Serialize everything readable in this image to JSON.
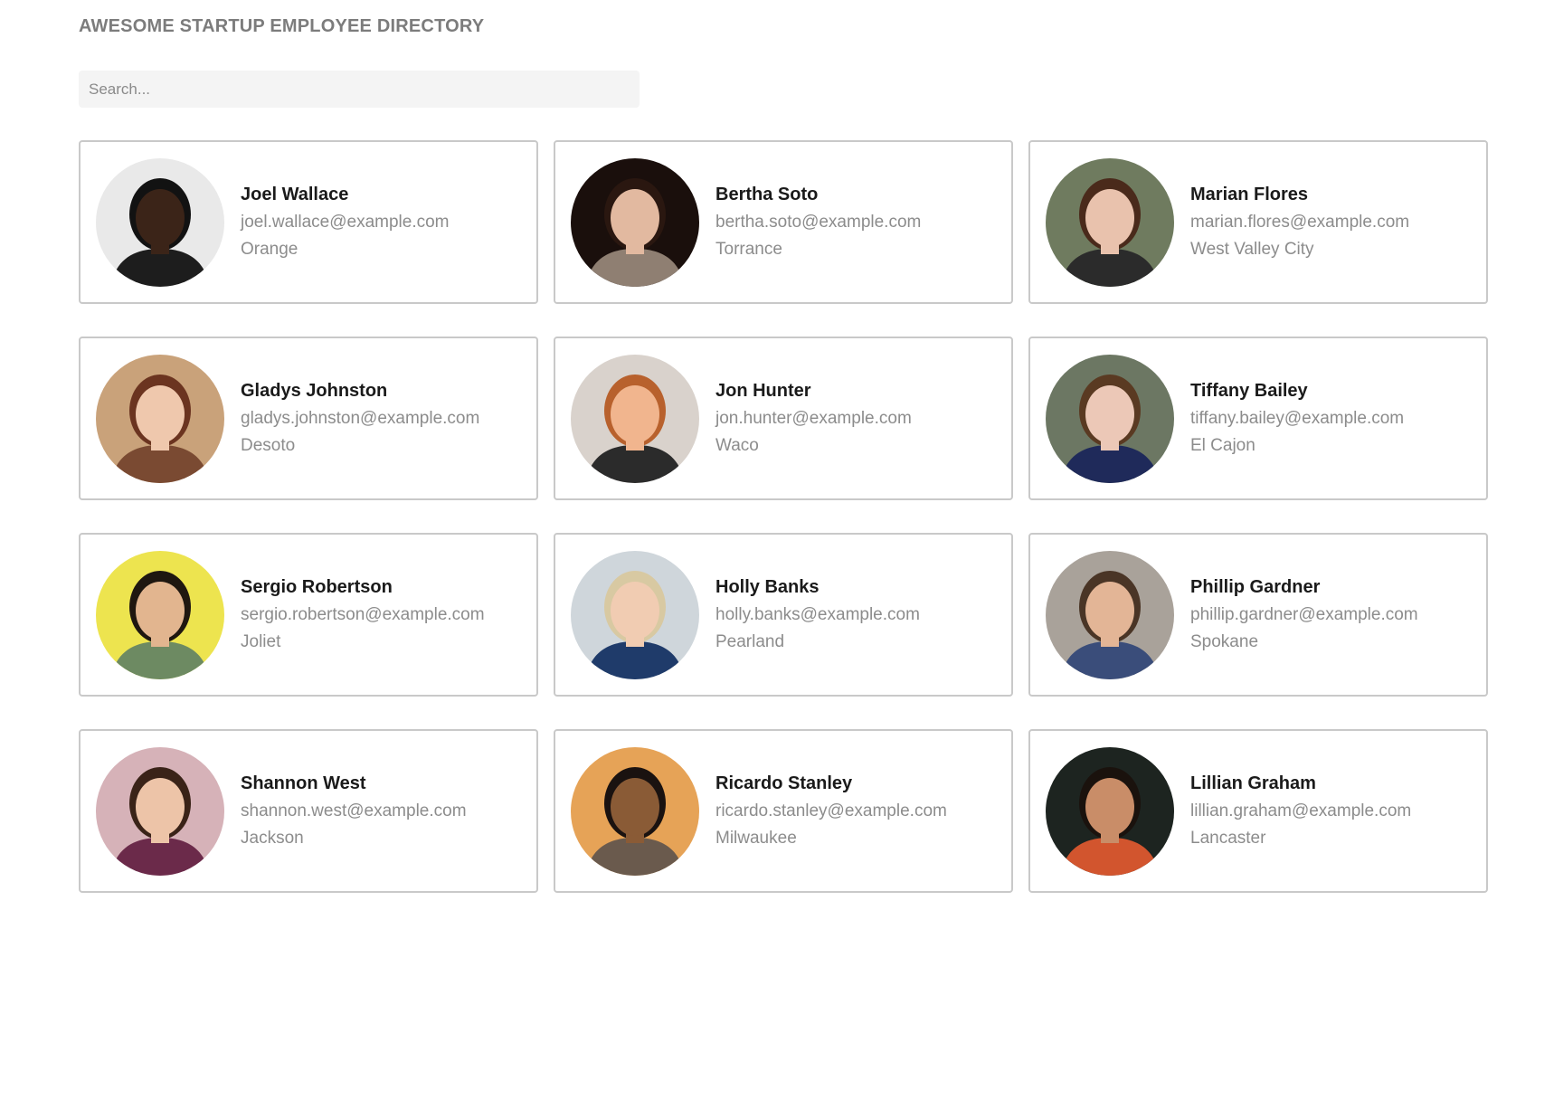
{
  "header": {
    "title": "AWESOME STARTUP EMPLOYEE DIRECTORY"
  },
  "search": {
    "placeholder": "Search..."
  },
  "employees": [
    {
      "name": "Joel Wallace",
      "email": "joel.wallace@example.com",
      "city": "Orange",
      "avatar_bg": "#e9e9e9",
      "skin": "#3b2418",
      "hair": "#121212",
      "shirt": "#1d1d1d"
    },
    {
      "name": "Bertha Soto",
      "email": "bertha.soto@example.com",
      "city": "Torrance",
      "avatar_bg": "#1a0f0c",
      "skin": "#e2b9a0",
      "hair": "#2a1710",
      "shirt": "#8f7f72"
    },
    {
      "name": "Marian Flores",
      "email": "marian.flores@example.com",
      "city": "West Valley City",
      "avatar_bg": "#6f7b5f",
      "skin": "#e9c2ad",
      "hair": "#4a2a1b",
      "shirt": "#2b2b2b"
    },
    {
      "name": "Gladys Johnston",
      "email": "gladys.johnston@example.com",
      "city": "Desoto",
      "avatar_bg": "#c9a27a",
      "skin": "#efc8ad",
      "hair": "#6b3420",
      "shirt": "#7a4a32"
    },
    {
      "name": "Jon Hunter",
      "email": "jon.hunter@example.com",
      "city": "Waco",
      "avatar_bg": "#d9d2cc",
      "skin": "#f1b58e",
      "hair": "#b8612d",
      "shirt": "#2b2b2b"
    },
    {
      "name": "Tiffany Bailey",
      "email": "tiffany.bailey@example.com",
      "city": "El Cajon",
      "avatar_bg": "#6c7763",
      "skin": "#ecc8b7",
      "hair": "#5a3a22",
      "shirt": "#1f2a5a"
    },
    {
      "name": "Sergio Robertson",
      "email": "sergio.robertson@example.com",
      "city": "Joliet",
      "avatar_bg": "#ede44f",
      "skin": "#e2b58f",
      "hair": "#1f1710",
      "shirt": "#6d8a62"
    },
    {
      "name": "Holly Banks",
      "email": "holly.banks@example.com",
      "city": "Pearland",
      "avatar_bg": "#cfd6db",
      "skin": "#f1ccb2",
      "hair": "#d8c9a2",
      "shirt": "#1f3b6a"
    },
    {
      "name": "Phillip Gardner",
      "email": "phillip.gardner@example.com",
      "city": "Spokane",
      "avatar_bg": "#a9a29a",
      "skin": "#e3b596",
      "hair": "#4a3526",
      "shirt": "#3a4d7a"
    },
    {
      "name": "Shannon West",
      "email": "shannon.west@example.com",
      "city": "Jackson",
      "avatar_bg": "#d6b2b8",
      "skin": "#edc4a8",
      "hair": "#3a2318",
      "shirt": "#6b2a4a"
    },
    {
      "name": "Ricardo Stanley",
      "email": "ricardo.stanley@example.com",
      "city": "Milwaukee",
      "avatar_bg": "#e6a357",
      "skin": "#8a5b36",
      "hair": "#1a1210",
      "shirt": "#6a5a4d"
    },
    {
      "name": "Lillian Graham",
      "email": "lillian.graham@example.com",
      "city": "Lancaster",
      "avatar_bg": "#1d2420",
      "skin": "#c98d68",
      "hair": "#1a120d",
      "shirt": "#d2552e"
    }
  ]
}
